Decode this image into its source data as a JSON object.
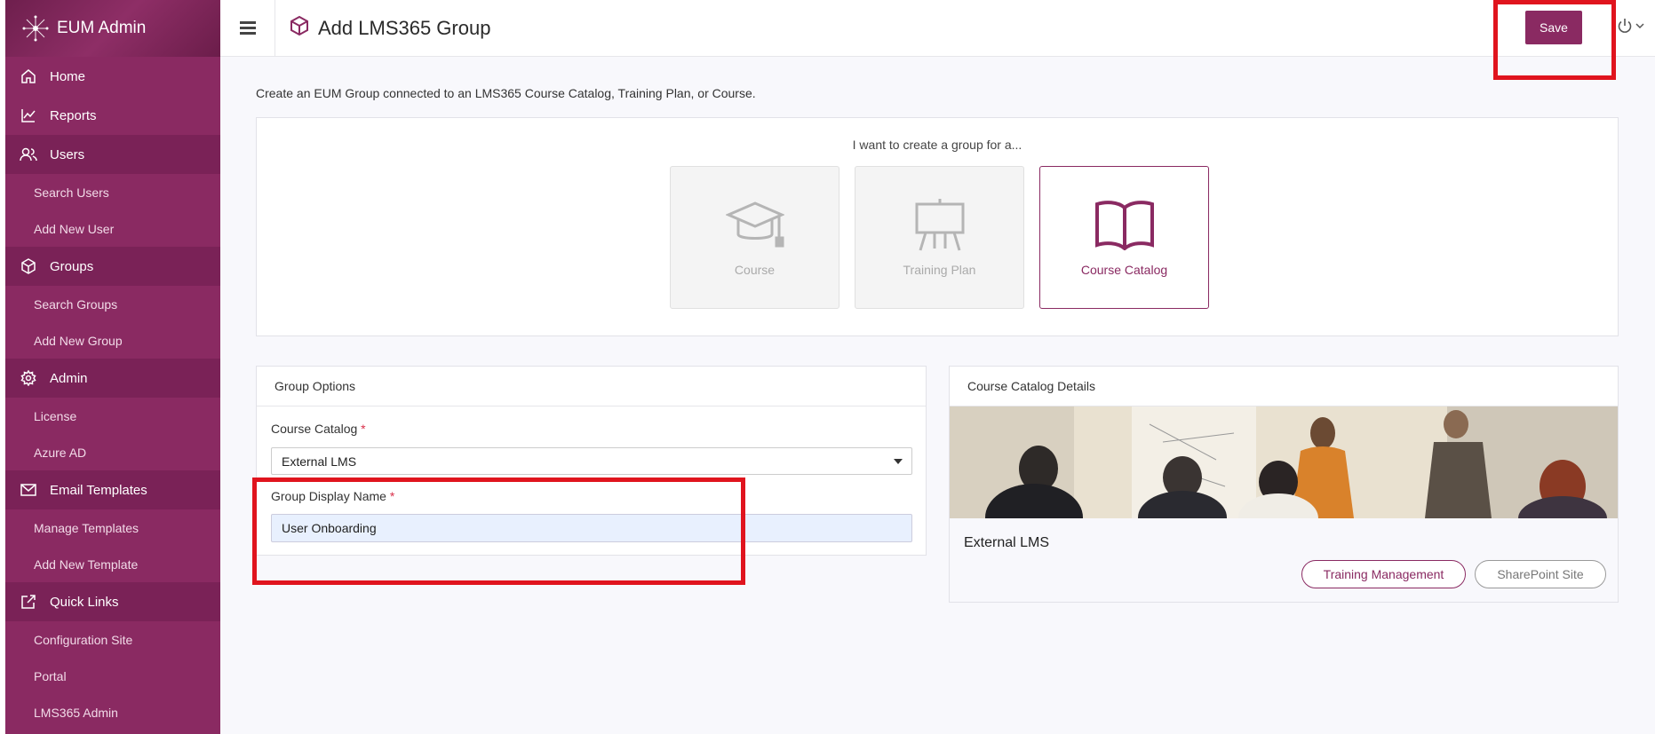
{
  "app": {
    "name": "EUM Admin"
  },
  "sidebar": {
    "home": "Home",
    "reports": "Reports",
    "users": "Users",
    "search_users": "Search Users",
    "add_new_user": "Add New User",
    "groups": "Groups",
    "search_groups": "Search Groups",
    "add_new_group": "Add New Group",
    "admin": "Admin",
    "license": "License",
    "azure_ad": "Azure AD",
    "email_templates": "Email Templates",
    "manage_templates": "Manage Templates",
    "add_new_template": "Add New Template",
    "quick_links": "Quick Links",
    "configuration_site": "Configuration Site",
    "portal": "Portal",
    "lms365_admin": "LMS365 Admin"
  },
  "header": {
    "title": "Add LMS365 Group",
    "save_label": "Save"
  },
  "main": {
    "intro": "Create an EUM Group connected to an LMS365 Course Catalog, Training Plan, or Course.",
    "chooser_heading": "I want to create a group for a...",
    "options": {
      "course": "Course",
      "training_plan": "Training Plan",
      "course_catalog": "Course Catalog"
    },
    "selected_option": "Course Catalog"
  },
  "group_options": {
    "header": "Group Options",
    "catalog_label": "Course Catalog",
    "catalog_value": "External LMS",
    "display_name_label": "Group Display Name",
    "display_name_value": "User Onboarding",
    "required_mark": "*"
  },
  "catalog_details": {
    "header": "Course Catalog Details",
    "name": "External LMS",
    "training_management": "Training Management",
    "sharepoint_site": "SharePoint Site"
  },
  "colors": {
    "brand": "#8a2a62",
    "highlight": "#e0141e"
  }
}
